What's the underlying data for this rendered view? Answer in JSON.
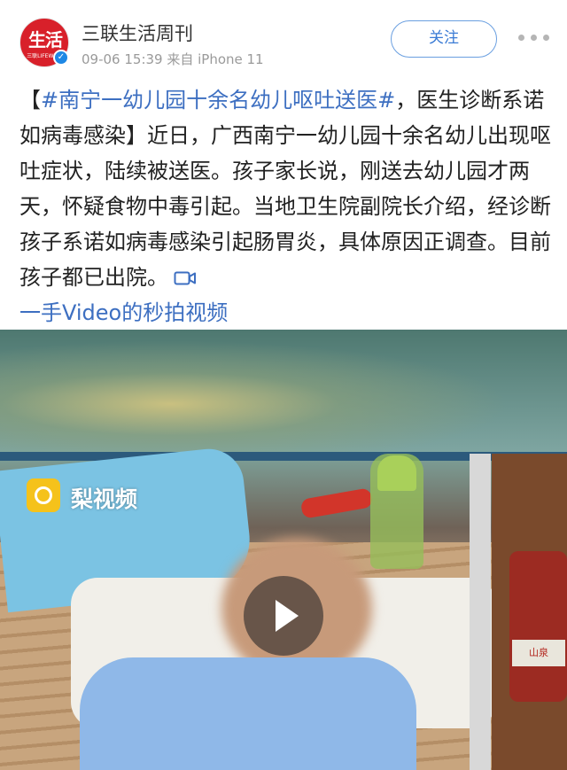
{
  "header": {
    "username": "三联生活周刊",
    "avatar_text": "生活",
    "avatar_subtext": "三联LIFEWEEK",
    "meta": "09-06 15:39 来自 iPhone 11",
    "follow_label": "关注"
  },
  "post": {
    "bracket_open": "【",
    "hashtag": "#南宁一幼儿园十余名幼儿呕吐送医#",
    "headline_rest": "，医生诊断系诺如病毒感染】",
    "body": "近日，广西南宁一幼儿园十余名幼儿出现呕吐症状，陆续被送医。孩子家长说，刚送去幼儿园才两天，怀疑食物中毒引起。当地卫生院副院长介绍，经诊断孩子系诺如病毒感染引起肠胃炎，具体原因正调查。目前孩子都已出院。",
    "video_link": "一手Video的秒拍视频"
  },
  "media": {
    "watermark": "梨视频",
    "jar_label": "山泉"
  },
  "icons": {
    "verified": "verified-badge-icon",
    "more": "more-dots-icon",
    "video": "video-camera-icon",
    "play": "play-icon",
    "watermark_logo": "pear-video-logo-icon"
  },
  "colors": {
    "link_blue": "#3d6fc1",
    "follow_border": "#6a9fe0",
    "avatar_red": "#d8202a"
  }
}
